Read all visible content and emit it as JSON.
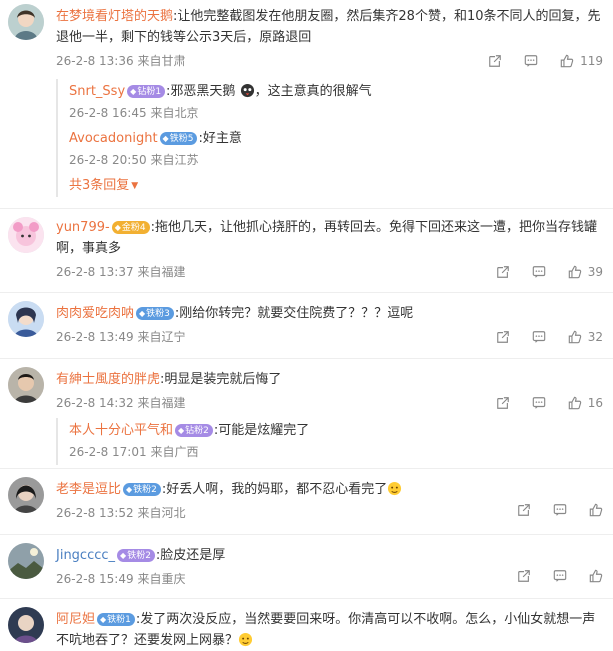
{
  "comments": [
    {
      "user": "在梦境看灯塔的天鹅",
      "text": ":让他完整截图发在他朋友圈，然后集齐28个赞，和10条不同人的回复，先退他一半，剩下的钱等公示3天后，原路退回",
      "time": "26-2-8 13:36",
      "location": "来自甘肃",
      "likes": "119",
      "replies": [
        {
          "user": "Snrt_Ssy",
          "badge": "钻粉1",
          "text": ":邪恶黑天鹅",
          "text2": "，这主意真的很解气",
          "time": "26-2-8 16:45",
          "location": "来自北京"
        },
        {
          "user": "Avocadonight",
          "badge": "铁粉5",
          "text": ":好主意",
          "time": "26-2-8 20:50",
          "location": "来自江苏"
        }
      ],
      "more_replies": "共3条回复"
    },
    {
      "user": "yun799-",
      "badge": "金粉4",
      "text": ":拖他几天，让他抓心挠肝的，再转回去。免得下回还来这一遭，把你当存钱罐啊，事真多",
      "time": "26-2-8 13:37",
      "location": "来自福建",
      "likes": "39"
    },
    {
      "user": "肉肉爱吃肉呐",
      "badge": "铁粉3",
      "text": ":刚给你转完？就要交住院费了？？？逗呢",
      "time": "26-2-8 13:49",
      "location": "来自辽宁",
      "likes": "32"
    },
    {
      "user": "有紳士風度的胖虎",
      "text": ":明显是装完就后悔了",
      "time": "26-2-8 14:32",
      "location": "来自福建",
      "likes": "16",
      "replies": [
        {
          "user": "本人十分心平气和",
          "badge": "钻粉2",
          "text": ":可能是炫耀完了",
          "time": "26-2-8 17:01",
          "location": "来自广西"
        }
      ]
    },
    {
      "user": "老李是逗比",
      "badge": "铁粉2",
      "text": ":好丢人啊，我的妈耶，都不忍心看完了",
      "time": "26-2-8 13:52",
      "location": "来自河北",
      "likes": ""
    },
    {
      "user": "Jingcccc_",
      "badge": "铁粉2",
      "text": ":脸皮还是厚",
      "time": "26-2-8 15:49",
      "location": "来自重庆",
      "likes": ""
    },
    {
      "user": "阿尼妲",
      "badge": "铁粉1",
      "text": ":发了两次没反应，当然要要回来呀。你清高可以不收啊。怎么，小仙女就想一声不吭地吞了？还要发网上网暴？",
      "time": "",
      "location": "",
      "likes": ""
    }
  ],
  "colors": {
    "username": "#eb7340",
    "username_blue": "#4a7fc1",
    "meta": "#888888"
  },
  "icons": [
    "share-icon",
    "comment-icon",
    "like-icon",
    "chevron-down-icon"
  ]
}
